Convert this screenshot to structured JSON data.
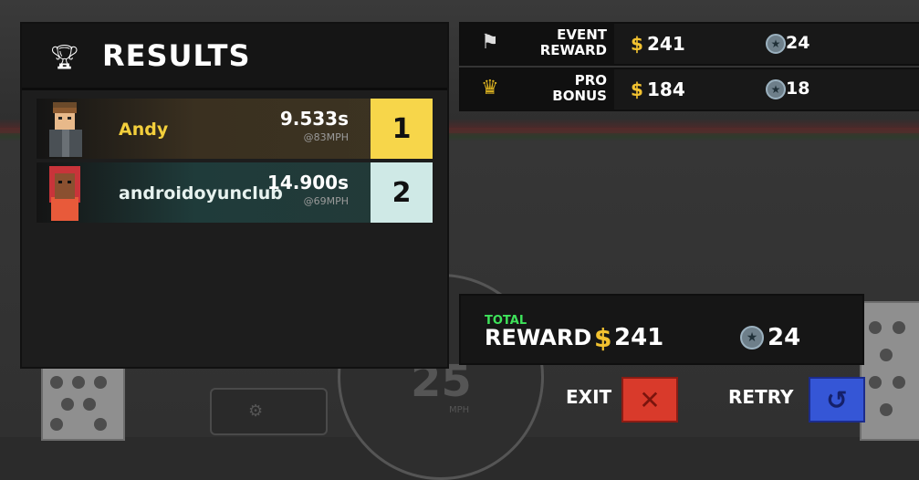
{
  "results": {
    "title": "RESULTS",
    "trophy_icon": "trophy-icon",
    "racers": [
      {
        "name": "Andy",
        "time": "9.533s",
        "speed": "@83MPH",
        "position": "1",
        "avatar_icon": "male-driver-avatar"
      },
      {
        "name": "androidoyunclub",
        "time": "14.900s",
        "speed": "@69MPH",
        "position": "2",
        "avatar_icon": "female-driver-avatar"
      }
    ]
  },
  "rewards": {
    "event": {
      "line1": "EVENT",
      "line2": "REWARD",
      "icon": "checkered-flag-icon",
      "cash_symbol": "$",
      "cash": "241",
      "coins": "24"
    },
    "pro": {
      "line1": "PRO",
      "line2": "BONUS",
      "icon": "crown-icon",
      "cash_symbol": "$",
      "cash": "184",
      "coins": "18"
    }
  },
  "total": {
    "small_label": "TOTAL",
    "label": "REWARD",
    "cash_symbol": "$",
    "cash": "241",
    "coins": "24"
  },
  "buttons": {
    "exit_label": "EXIT",
    "exit_glyph": "✕",
    "retry_label": "RETRY",
    "retry_glyph": "↺"
  },
  "background": {
    "speedometer_value": "25",
    "speedometer_unit": "MPH"
  },
  "colors": {
    "gold": "#f7d64a",
    "silver": "#cfe9e6",
    "cash": "#f2c230",
    "total_green": "#3ee25a",
    "exit_red": "#d93a2b",
    "retry_blue": "#3556d6"
  }
}
